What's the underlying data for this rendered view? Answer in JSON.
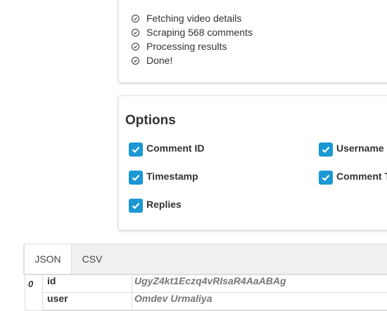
{
  "progress": {
    "steps": [
      "Fetching video details",
      "Scraping 568 comments",
      "Processing results",
      "Done!"
    ]
  },
  "options": {
    "title": "Options",
    "items": [
      {
        "label": "Comment ID",
        "checked": true
      },
      {
        "label": "Username",
        "checked": true
      },
      {
        "label": "Timestamp",
        "checked": true
      },
      {
        "label": "Comment T",
        "checked": true
      },
      {
        "label": "Replies",
        "checked": true
      }
    ],
    "check_color": "#1b97d4"
  },
  "tabs": [
    {
      "label": "JSON",
      "active": true
    },
    {
      "label": "CSV",
      "active": false
    }
  ],
  "results": {
    "index": "0",
    "rows": [
      {
        "key": "id",
        "value": "UgyZ4kt1Eczq4vRIsaR4AaABAg"
      },
      {
        "key": "user",
        "value": "Omdev Urmaliya"
      }
    ]
  }
}
